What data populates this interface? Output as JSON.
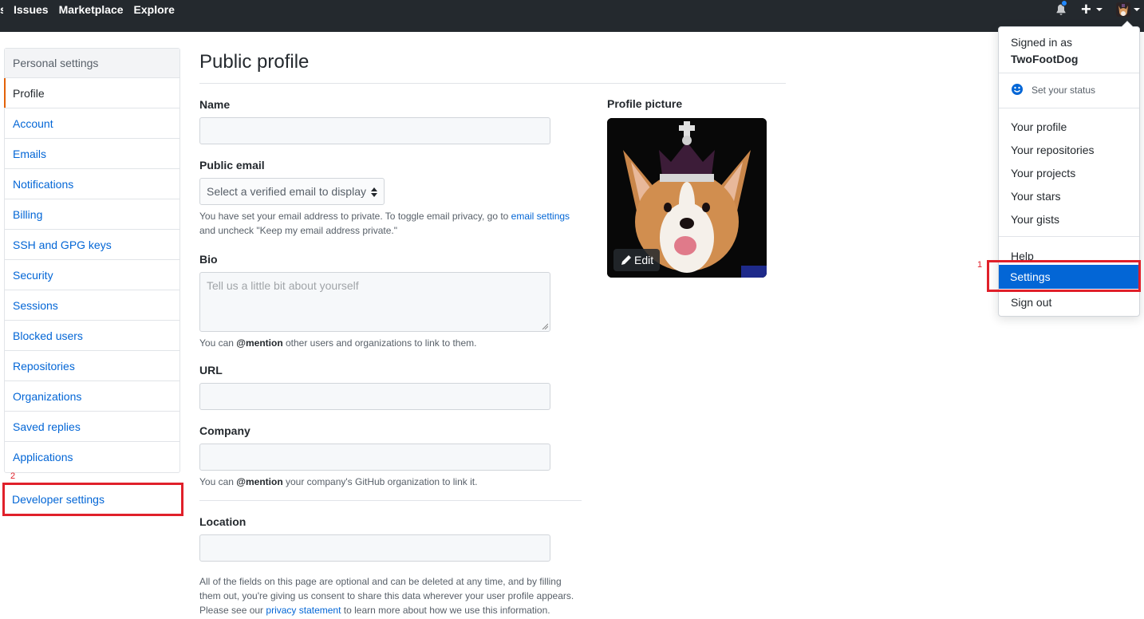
{
  "header": {
    "nav": [
      "Issues",
      "Marketplace",
      "Explore"
    ],
    "edge_glyph": "s"
  },
  "sidebar": {
    "heading": "Personal settings",
    "items": [
      {
        "label": "Profile",
        "selected": true
      },
      {
        "label": "Account"
      },
      {
        "label": "Emails"
      },
      {
        "label": "Notifications"
      },
      {
        "label": "Billing"
      },
      {
        "label": "SSH and GPG keys"
      },
      {
        "label": "Security"
      },
      {
        "label": "Sessions"
      },
      {
        "label": "Blocked users"
      },
      {
        "label": "Repositories"
      },
      {
        "label": "Organizations"
      },
      {
        "label": "Saved replies"
      },
      {
        "label": "Applications"
      }
    ],
    "developer_settings": "Developer settings"
  },
  "annotations": {
    "one": "1",
    "two": "2"
  },
  "main": {
    "title": "Public profile",
    "name_label": "Name",
    "name_value": "",
    "public_email_label": "Public email",
    "public_email_select": "Select a verified email to display",
    "email_note_1": "You have set your email address to private. To toggle email privacy, go to",
    "email_note_link": "email settings",
    "email_note_2": "and uncheck \"Keep my email address private.\"",
    "bio_label": "Bio",
    "bio_placeholder": "Tell us a little bit about yourself",
    "bio_note_pre": "You can",
    "bio_note_mention": "@mention",
    "bio_note_post": "other users and organizations to link to them.",
    "url_label": "URL",
    "company_label": "Company",
    "company_note_pre": "You can",
    "company_note_mention": "@mention",
    "company_note_post": "your company's GitHub organization to link it.",
    "location_label": "Location",
    "footer_1": "All of the fields on this page are optional and can be deleted at any time, and by filling",
    "footer_2": "them out, you're giving us consent to share this data wherever your user profile appears.",
    "footer_3_pre": "Please see our",
    "footer_3_link": "privacy statement",
    "footer_3_post": "to learn more about how we use this information.",
    "picture_label": "Profile picture",
    "edit_label": "Edit"
  },
  "dropdown": {
    "signed_in_as": "Signed in as",
    "username": "TwoFootDog",
    "set_status": "Set your status",
    "items_1": [
      "Your profile",
      "Your repositories",
      "Your projects",
      "Your stars",
      "Your gists"
    ],
    "help": "Help",
    "settings": "Settings",
    "sign_out": "Sign out"
  },
  "colors": {
    "header_bg": "#24292e",
    "link": "#0366d6",
    "annotation_red": "#e0202a",
    "selected_bar": "#e36209"
  }
}
